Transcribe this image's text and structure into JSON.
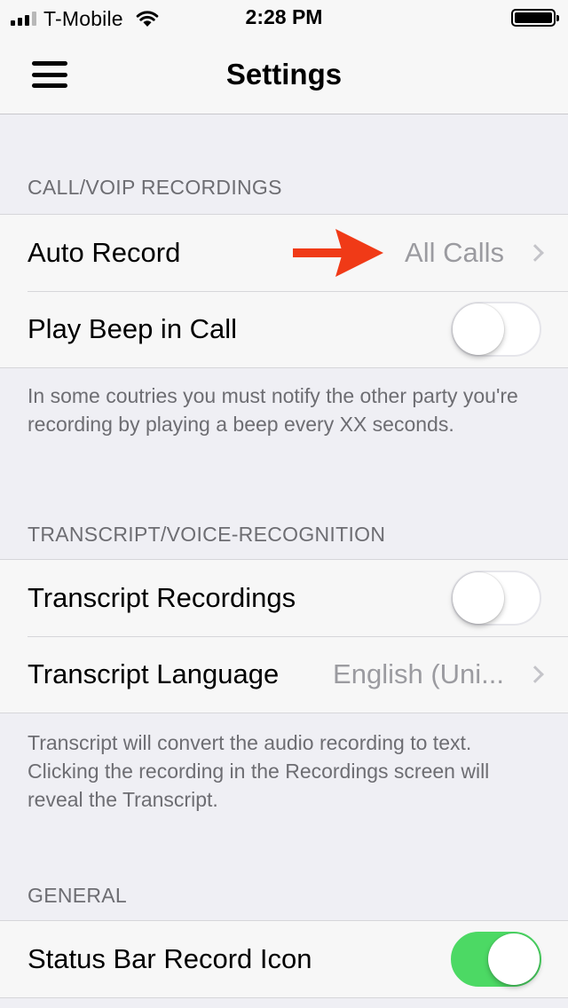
{
  "status_bar": {
    "carrier": "T-Mobile",
    "time": "2:28 PM",
    "signal_bars_filled": 3,
    "signal_bars_total": 4
  },
  "nav": {
    "title": "Settings",
    "menu_icon": "hamburger-menu-icon"
  },
  "sections": {
    "call": {
      "header": "CALL/VOIP RECORDINGS",
      "auto_record_label": "Auto Record",
      "auto_record_value": "All Calls",
      "play_beep_label": "Play Beep in Call",
      "play_beep_on": false,
      "footer": "In some coutries you must notify the other party you're recording by playing a beep every XX seconds."
    },
    "transcript": {
      "header": "TRANSCRIPT/VOICE-RECOGNITION",
      "recordings_label": "Transcript Recordings",
      "recordings_on": false,
      "language_label": "Transcript Language",
      "language_value": "English (Uni...",
      "footer_line1": "Transcript will convert the audio recording to text.",
      "footer_line2": "Clicking the recording in the Recordings screen will reveal the Transcript."
    },
    "general": {
      "header": "GENERAL",
      "status_bar_icon_label": "Status Bar Record Icon",
      "status_bar_icon_on": true
    }
  },
  "colors": {
    "toggle_on": "#4cd964",
    "annotation_arrow": "#f03a17",
    "secondary_text": "#6d6d72"
  }
}
